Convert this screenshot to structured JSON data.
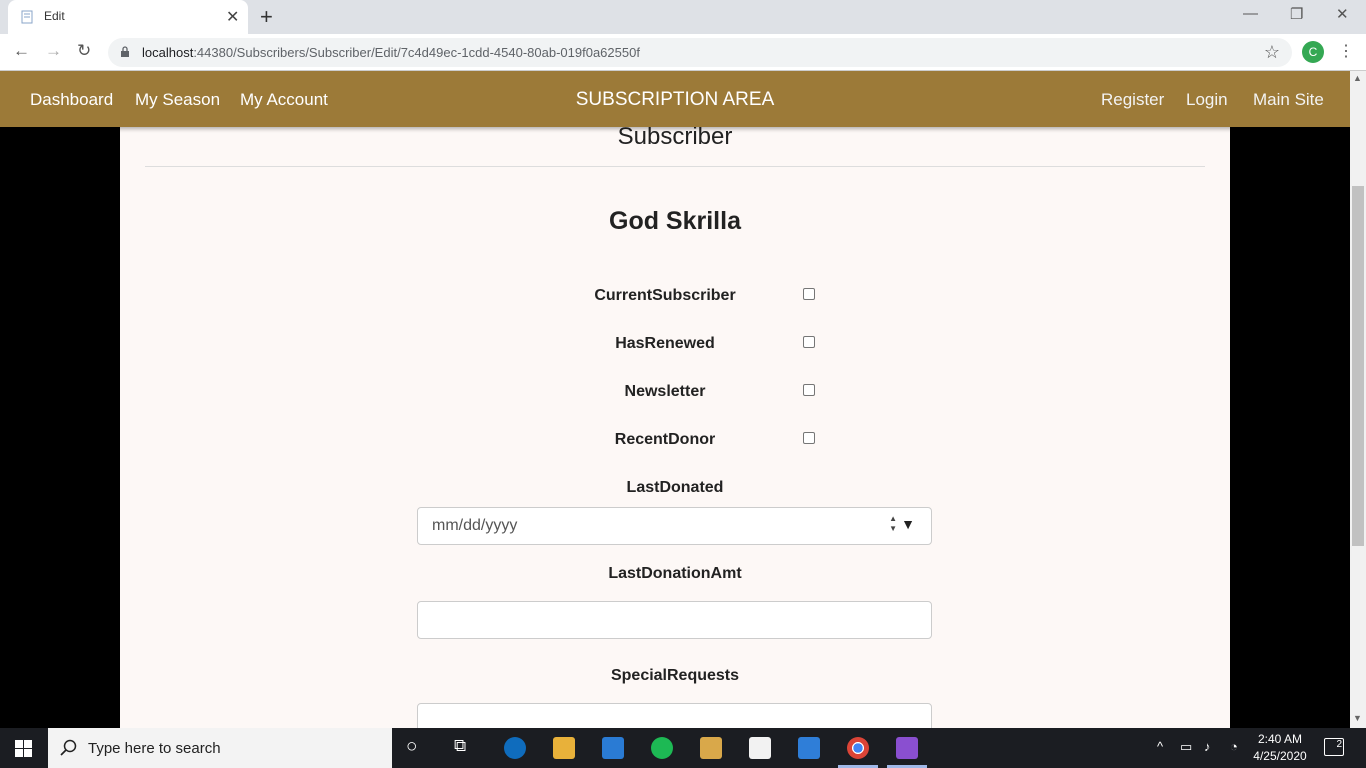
{
  "browser": {
    "tab_title": "Edit",
    "url_host": "localhost",
    "url_rest": ":44380/Subscribers/Subscriber/Edit/7c4d49ec-1cdd-4540-80ab-019f0a62550f",
    "profile_initial": "C"
  },
  "navbar": {
    "left_links": [
      "Dashboard",
      "My Season",
      "My Account"
    ],
    "brand": "SUBSCRIPTION AREA",
    "right_links": [
      "Register",
      "Login",
      "Main Site"
    ],
    "color": "#9c7a38"
  },
  "page": {
    "heading": "Subscriber",
    "name": "God Skrilla",
    "checkboxes": [
      {
        "label": "CurrentSubscriber",
        "checked": false
      },
      {
        "label": "HasRenewed",
        "checked": false
      },
      {
        "label": "Newsletter",
        "checked": false
      },
      {
        "label": "RecentDonor",
        "checked": false
      }
    ],
    "last_donated_label": "LastDonated",
    "last_donated_placeholder": "mm/dd/yyyy",
    "last_donation_amt_label": "LastDonationAmt",
    "last_donation_amt_value": "",
    "special_requests_label": "SpecialRequests",
    "special_requests_value": ""
  },
  "taskbar": {
    "search_placeholder": "Type here to search",
    "time": "2:40 AM",
    "date": "4/25/2020",
    "notification_count": "2"
  }
}
